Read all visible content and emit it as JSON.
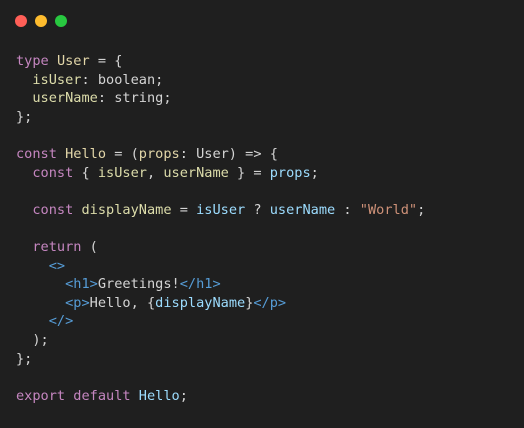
{
  "window": {
    "traffic_lights": [
      {
        "name": "close",
        "color": "#ff5f57"
      },
      {
        "name": "minimize",
        "color": "#febc2e"
      },
      {
        "name": "maximize",
        "color": "#28c840"
      }
    ]
  },
  "colors": {
    "background": "#1f1f1f",
    "keyword": "#c586c0",
    "plain": "#d4d4d4",
    "type_name": "#e2d6a8",
    "property": "#dcdcaa",
    "variable": "#9cdcfe",
    "tag": "#569cd6",
    "string": "#ce9178"
  },
  "code_lines": [
    [
      {
        "t": "type",
        "c": "keyword"
      },
      {
        "t": " ",
        "c": "plain"
      },
      {
        "t": "User",
        "c": "type-name"
      },
      {
        "t": " = {",
        "c": "plain"
      }
    ],
    [
      {
        "t": "  ",
        "c": "plain"
      },
      {
        "t": "isUser",
        "c": "prop"
      },
      {
        "t": ": boolean;",
        "c": "plain"
      }
    ],
    [
      {
        "t": "  ",
        "c": "plain"
      },
      {
        "t": "userName",
        "c": "prop"
      },
      {
        "t": ": string;",
        "c": "plain"
      }
    ],
    [
      {
        "t": "};",
        "c": "plain"
      }
    ],
    [],
    [
      {
        "t": "const",
        "c": "keyword"
      },
      {
        "t": " ",
        "c": "plain"
      },
      {
        "t": "Hello",
        "c": "type-name"
      },
      {
        "t": " = (",
        "c": "plain"
      },
      {
        "t": "props",
        "c": "type-name"
      },
      {
        "t": ": User) => {",
        "c": "plain"
      }
    ],
    [
      {
        "t": "  ",
        "c": "plain"
      },
      {
        "t": "const",
        "c": "keyword"
      },
      {
        "t": " { ",
        "c": "plain"
      },
      {
        "t": "isUser",
        "c": "prop"
      },
      {
        "t": ", ",
        "c": "plain"
      },
      {
        "t": "userName",
        "c": "prop"
      },
      {
        "t": " } = ",
        "c": "plain"
      },
      {
        "t": "props",
        "c": "var"
      },
      {
        "t": ";",
        "c": "plain"
      }
    ],
    [],
    [
      {
        "t": "  ",
        "c": "plain"
      },
      {
        "t": "const",
        "c": "keyword"
      },
      {
        "t": " ",
        "c": "plain"
      },
      {
        "t": "displayName",
        "c": "prop"
      },
      {
        "t": " = ",
        "c": "plain"
      },
      {
        "t": "isUser",
        "c": "var"
      },
      {
        "t": " ? ",
        "c": "plain"
      },
      {
        "t": "userName",
        "c": "var"
      },
      {
        "t": " : ",
        "c": "plain"
      },
      {
        "t": "\"World\"",
        "c": "string"
      },
      {
        "t": ";",
        "c": "plain"
      }
    ],
    [],
    [
      {
        "t": "  ",
        "c": "plain"
      },
      {
        "t": "return",
        "c": "keyword"
      },
      {
        "t": " (",
        "c": "plain"
      }
    ],
    [
      {
        "t": "    ",
        "c": "plain"
      },
      {
        "t": "<>",
        "c": "tag"
      }
    ],
    [
      {
        "t": "      ",
        "c": "plain"
      },
      {
        "t": "<h1>",
        "c": "tag"
      },
      {
        "t": "Greetings!",
        "c": "plain"
      },
      {
        "t": "</h1>",
        "c": "tag"
      }
    ],
    [
      {
        "t": "      ",
        "c": "plain"
      },
      {
        "t": "<p>",
        "c": "tag"
      },
      {
        "t": "Hello, {",
        "c": "plain"
      },
      {
        "t": "displayName",
        "c": "var"
      },
      {
        "t": "}",
        "c": "plain"
      },
      {
        "t": "</p>",
        "c": "tag"
      }
    ],
    [
      {
        "t": "    ",
        "c": "plain"
      },
      {
        "t": "</>",
        "c": "tag"
      }
    ],
    [
      {
        "t": "  );",
        "c": "plain"
      }
    ],
    [
      {
        "t": "};",
        "c": "plain"
      }
    ],
    [],
    [
      {
        "t": "export",
        "c": "keyword"
      },
      {
        "t": " ",
        "c": "plain"
      },
      {
        "t": "default",
        "c": "keyword"
      },
      {
        "t": " ",
        "c": "plain"
      },
      {
        "t": "Hello",
        "c": "var"
      },
      {
        "t": ";",
        "c": "plain"
      }
    ]
  ]
}
